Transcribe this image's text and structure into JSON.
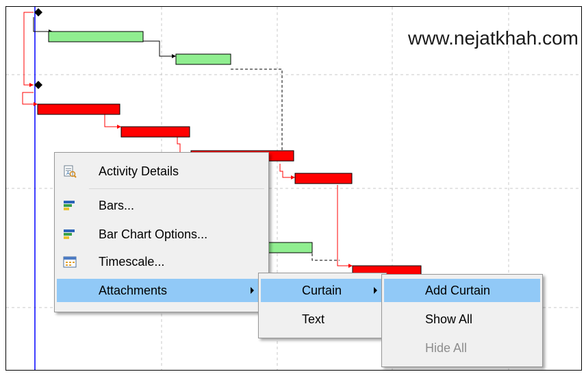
{
  "watermark": "www.nejatkhah.com",
  "context_menu": {
    "items": [
      {
        "label": "Activity Details",
        "icon": "activity-details-icon"
      },
      {
        "label": "Bars...",
        "icon": "bars-icon"
      },
      {
        "label": "Bar Chart Options...",
        "icon": "bar-chart-options-icon"
      },
      {
        "label": "Timescale...",
        "icon": "timescale-icon"
      },
      {
        "label": "Attachments",
        "icon": "",
        "submenu": true,
        "highlighted": true
      }
    ]
  },
  "attachments_submenu": {
    "items": [
      {
        "label": "Curtain",
        "submenu": true,
        "highlighted": true
      },
      {
        "label": "Text"
      }
    ]
  },
  "curtain_submenu": {
    "items": [
      {
        "label": "Add Curtain",
        "highlighted": true,
        "enabled": true
      },
      {
        "label": "Show All",
        "enabled": true
      },
      {
        "label": "Hide All",
        "enabled": false
      }
    ]
  },
  "colors": {
    "activity_bar_normal": "#90ee90",
    "activity_bar_critical": "#ff0000",
    "relationship_normal": "#000000",
    "relationship_critical": "#ff0000",
    "data_date_line": "#0000ff",
    "menu_highlight": "#91c9f7",
    "menu_background": "#f0f0f0"
  }
}
